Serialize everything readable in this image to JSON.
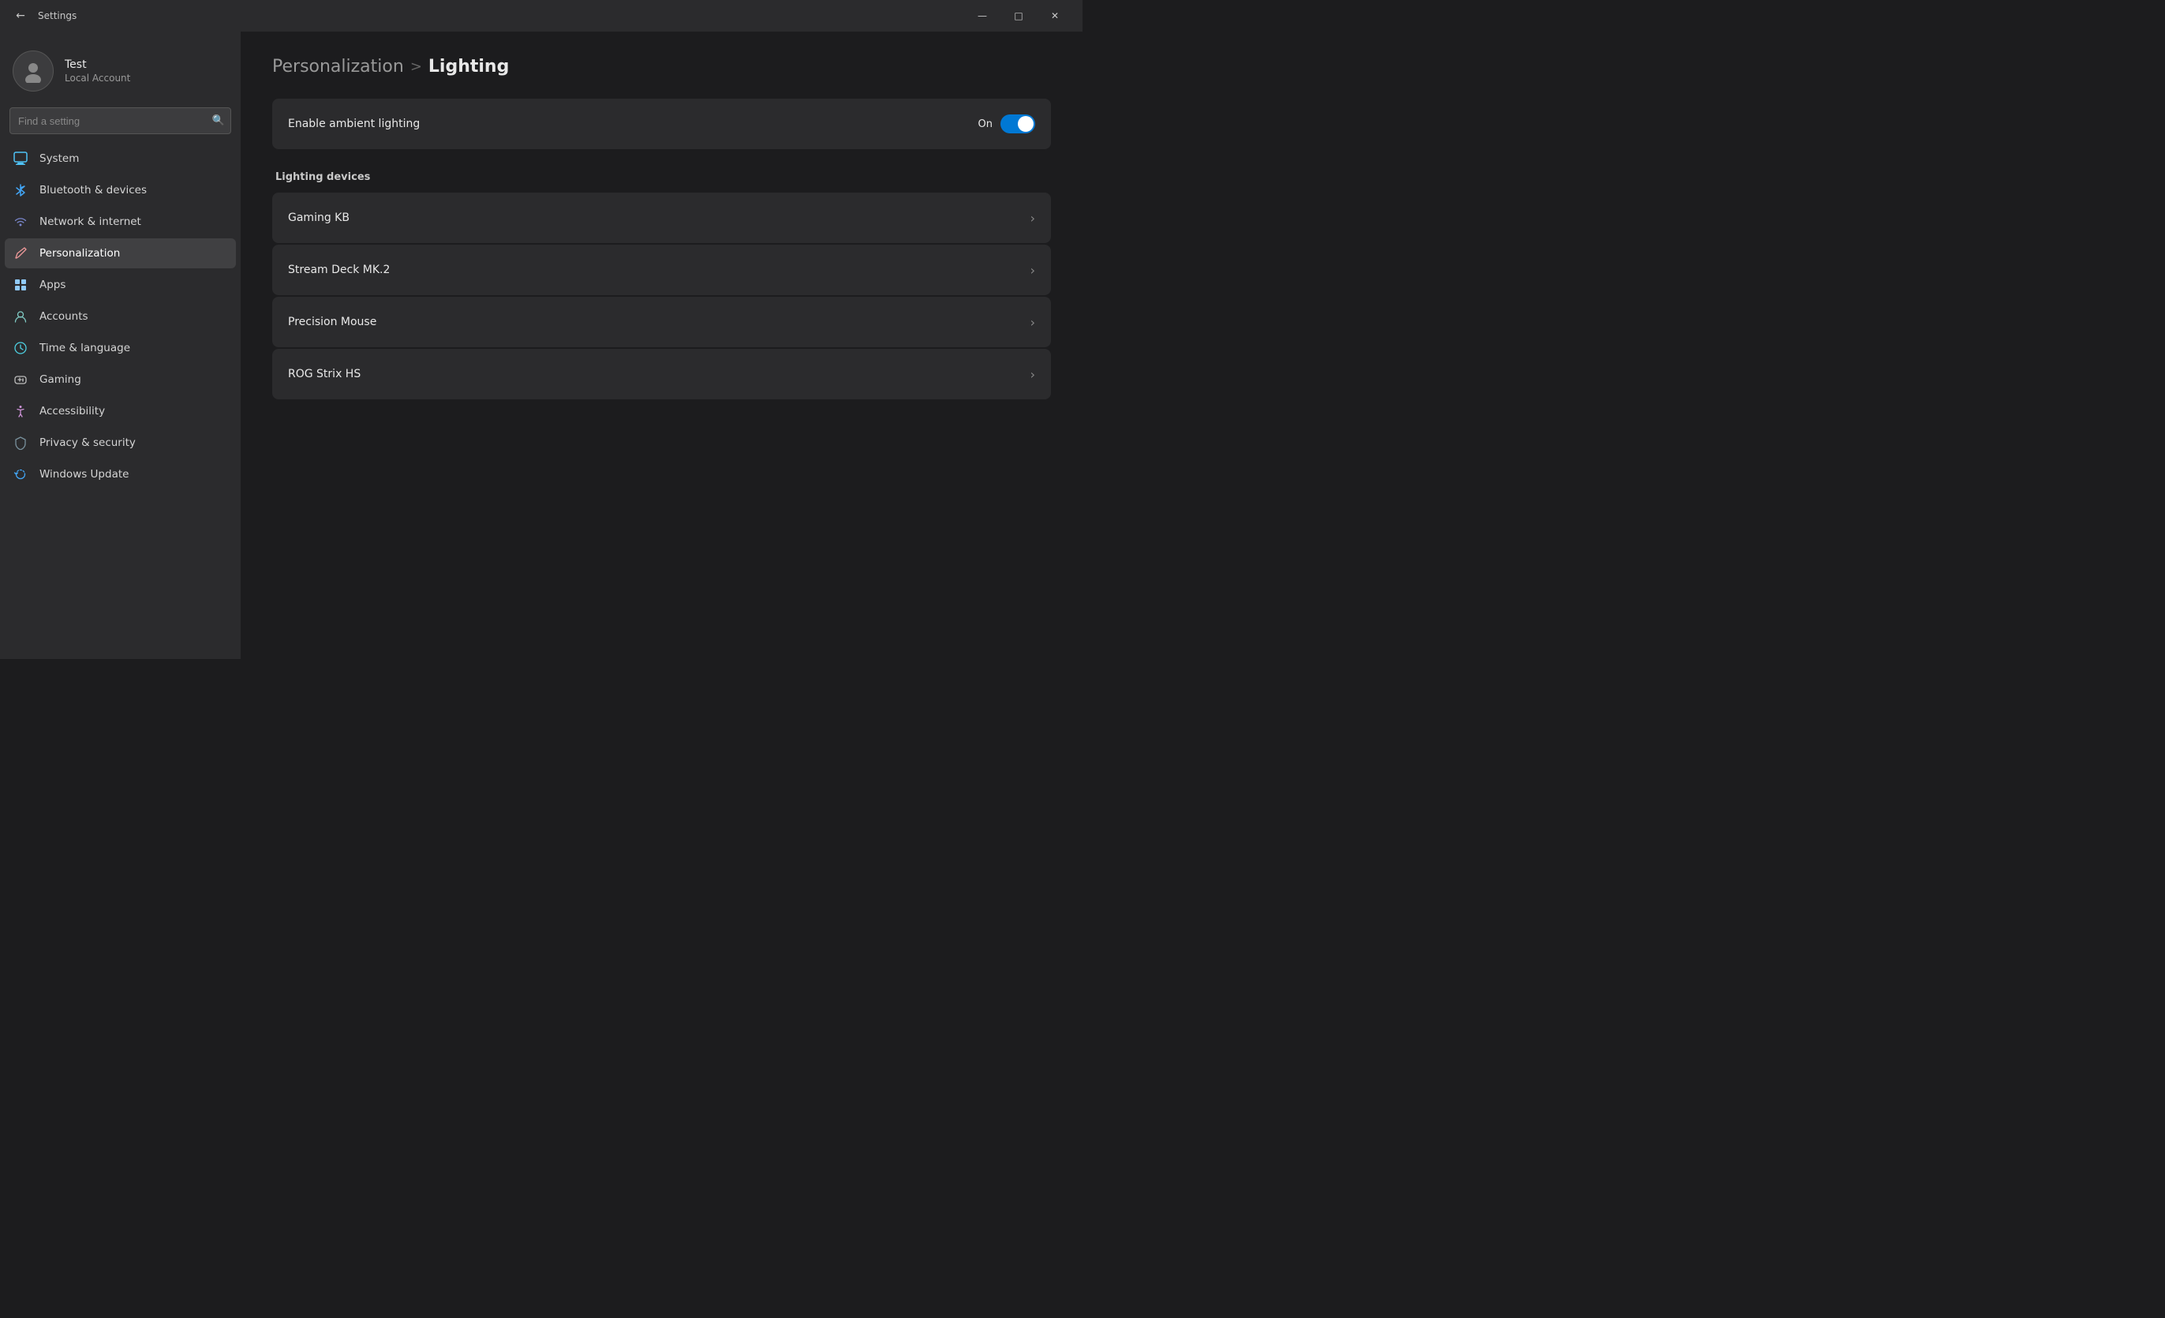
{
  "titlebar": {
    "back_label": "←",
    "title": "Settings",
    "minimize_label": "—",
    "maximize_label": "□",
    "close_label": "✕"
  },
  "sidebar": {
    "user": {
      "name": "Test",
      "account": "Local Account",
      "avatar_symbol": "👤"
    },
    "search": {
      "placeholder": "Find a setting"
    },
    "nav_items": [
      {
        "id": "system",
        "label": "System",
        "icon": "🖥",
        "icon_class": "icon-system",
        "active": false
      },
      {
        "id": "bluetooth",
        "label": "Bluetooth & devices",
        "icon": "⬤",
        "icon_class": "icon-bluetooth",
        "active": false
      },
      {
        "id": "network",
        "label": "Network & internet",
        "icon": "◈",
        "icon_class": "icon-network",
        "active": false
      },
      {
        "id": "personalization",
        "label": "Personalization",
        "icon": "✏",
        "icon_class": "icon-personalization",
        "active": true
      },
      {
        "id": "apps",
        "label": "Apps",
        "icon": "▦",
        "icon_class": "icon-apps",
        "active": false
      },
      {
        "id": "accounts",
        "label": "Accounts",
        "icon": "◉",
        "icon_class": "icon-accounts",
        "active": false
      },
      {
        "id": "time",
        "label": "Time & language",
        "icon": "🕐",
        "icon_class": "icon-time",
        "active": false
      },
      {
        "id": "gaming",
        "label": "Gaming",
        "icon": "🎮",
        "icon_class": "icon-gaming",
        "active": false
      },
      {
        "id": "accessibility",
        "label": "Accessibility",
        "icon": "♿",
        "icon_class": "icon-accessibility",
        "active": false
      },
      {
        "id": "privacy",
        "label": "Privacy & security",
        "icon": "🛡",
        "icon_class": "icon-privacy",
        "active": false
      },
      {
        "id": "update",
        "label": "Windows Update",
        "icon": "↻",
        "icon_class": "icon-update",
        "active": false
      }
    ]
  },
  "main": {
    "breadcrumb_parent": "Personalization",
    "breadcrumb_sep": ">",
    "breadcrumb_current": "Lighting",
    "ambient_lighting": {
      "label": "Enable ambient lighting",
      "state_text": "On",
      "enabled": true
    },
    "devices_section_label": "Lighting devices",
    "devices": [
      {
        "name": "Gaming KB"
      },
      {
        "name": "Stream Deck MK.2"
      },
      {
        "name": "Precision Mouse"
      },
      {
        "name": "ROG Strix HS"
      }
    ]
  }
}
